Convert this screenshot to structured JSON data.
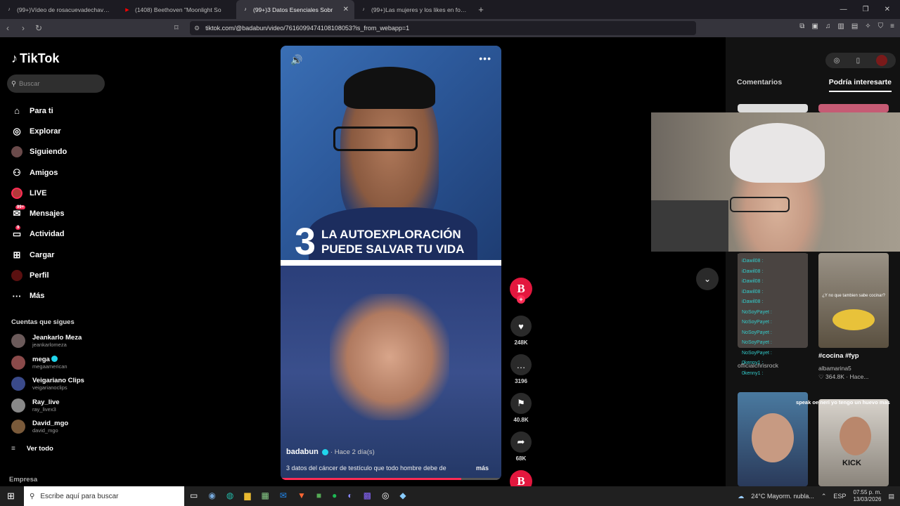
{
  "browser": {
    "tabs": [
      {
        "title": "(99+)Vídeo de rosacuevadechaves (@",
        "fav": "♪",
        "fav_color": "#111"
      },
      {
        "title": "(1408) Beethoven \"Moonlight So",
        "fav": "▶",
        "fav_color": "#ff0000"
      },
      {
        "title": "(99+)3 Datos Esenciales Sobr",
        "fav": "♪",
        "fav_color": "#111"
      },
      {
        "title": "(99+)Las mujeres y los likes en fotos",
        "fav": "♪",
        "fav_color": "#111"
      }
    ],
    "url": "tiktok.com/@badabun/video/7616099474108108053?is_from_webapp=1"
  },
  "sidebar": {
    "logo": "TikTok",
    "search_placeholder": "Buscar",
    "nav": [
      {
        "label": "Para ti",
        "icon": "home-icon",
        "glyph": "⌂"
      },
      {
        "label": "Explorar",
        "icon": "compass-icon",
        "glyph": "◎"
      },
      {
        "label": "Siguiendo",
        "icon": "following-avatar-icon",
        "glyph": "●"
      },
      {
        "label": "Amigos",
        "icon": "friends-icon",
        "glyph": "⚇"
      },
      {
        "label": "LIVE",
        "icon": "live-avatar-icon",
        "glyph": "●"
      },
      {
        "label": "Mensajes",
        "icon": "messages-icon",
        "glyph": "✉",
        "badge": "99+"
      },
      {
        "label": "Actividad",
        "icon": "activity-icon",
        "glyph": "▭",
        "badge": "9"
      },
      {
        "label": "Cargar",
        "icon": "upload-icon",
        "glyph": "⊞"
      },
      {
        "label": "Perfil",
        "icon": "profile-avatar-icon",
        "glyph": "●"
      },
      {
        "label": "Más",
        "icon": "more-icon",
        "glyph": "···"
      }
    ],
    "following_header": "Cuentas que sigues",
    "accounts": [
      {
        "name": "Jeankarlo Meza",
        "handle": "jeankarlomeza",
        "verified": false
      },
      {
        "name": "mega",
        "handle": "megaamerican",
        "verified": true
      },
      {
        "name": "Veigariano Clips",
        "handle": "veigarianoclips",
        "verified": false
      },
      {
        "name": "Ray_live",
        "handle": "ray_livex3",
        "verified": false
      },
      {
        "name": "David_mgo",
        "handle": "david_mgo",
        "verified": false
      }
    ],
    "see_all": "Ver todo",
    "footer": "Empresa"
  },
  "video": {
    "overlay_number": "3",
    "overlay_line1": "LA AUTOEXPLORACIÓN",
    "overlay_line2": "PUEDE SALVAR TU VIDA",
    "author": "badabun",
    "posted": "· Hace 2 día(s)",
    "description": "3 datos del cáncer de testículo que todo hombre debe de",
    "more": "más",
    "progress": 0.82
  },
  "actions": {
    "avatar_letter": "B",
    "likes": "248K",
    "comments": "3196",
    "saves": "40.8K",
    "shares": "68K"
  },
  "right_panel": {
    "tab_comments": "Comentarios",
    "tab_interest": "Podría interesarte",
    "cards": [
      {
        "user": "officialchrisrock",
        "stat": "",
        "caption": ""
      },
      {
        "caption": "#cocina #fyp",
        "user": "albamarina5",
        "stat": "364.8K · Hace...",
        "overlay": "¿Y no que tambien sabe cocinar?"
      },
      {
        "overlay": "speak oe neri yo tengo un huevo mas"
      }
    ]
  },
  "stream_chat": [
    "iDawil08 :",
    "iDawil08 :",
    "iDawil08 :",
    "iDawil08 :",
    "iDawil08 :",
    "NoSoyPayet :",
    "NoSoyPayet :",
    "NoSoyPayet :",
    "NoSoyPayet :",
    "NoSoyPayet :",
    "0kenny1 :",
    "0kenny1 :"
  ],
  "stream_overlay": {
    "kick": "KICK"
  },
  "taskbar": {
    "search_placeholder": "Escribe aquí para buscar",
    "weather": "24°C  Mayorm. nubla...",
    "lang": "ESP",
    "time": "07:55 p. m.",
    "date": "13/03/2026"
  }
}
